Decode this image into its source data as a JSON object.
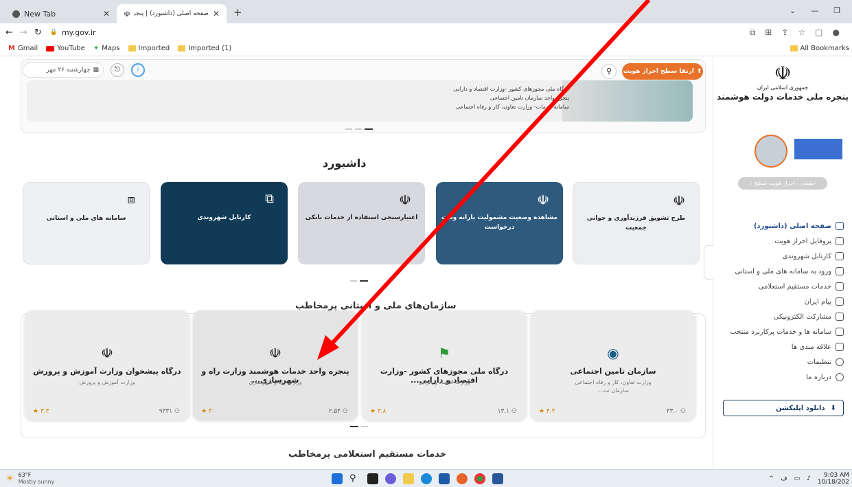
{
  "browser": {
    "tabs": [
      {
        "title": "New Tab"
      },
      {
        "title": "صفحه اصلی (داشبورد) | پنجره مل..."
      }
    ],
    "address": "my.gov.ir",
    "bookmarks": [
      "Gmail",
      "YouTube",
      "Maps",
      "Imported",
      "Imported (1)"
    ],
    "all_bookmarks": "All Bookmarks"
  },
  "header": {
    "date": "چهارشنبه ۲۶ مهر",
    "upgrade_button": "ارتقا سطح احراز هویت",
    "banner_lines": [
      "درگاه ملی مجوزهای کشور -وزارت اقتصاد و دارایی",
      "پنجره واحد سازمان تامین اجتماعی",
      "سامانه خدمات- وزارت تعاون، کار و رفاه اجتماعی"
    ]
  },
  "dashboard": {
    "title": "داشبورد",
    "cards": [
      {
        "label": "سامانه های ملی و استانی"
      },
      {
        "label": "کارتابل شهروندی"
      },
      {
        "label": "اعتبارسنجی استفاده از خدمات بانکی"
      },
      {
        "label": "مشاهده وضعیت مشمولیت یارانه وثبت درخواست"
      },
      {
        "label": "طرح تشویق فرزندآوری و جوانی جمعیت"
      }
    ]
  },
  "orgs": {
    "title": "سازمان‌های ملی و استانی پرمخاطب",
    "items": [
      {
        "title": "درگاه پیشخوان وزارت آموزش و پرورش",
        "sub": "وزارت آموزش و پرورش",
        "rating": "۳.۳",
        "count": "۹۳۳۱"
      },
      {
        "title": "پنجره واحد خدمات هوشمند وزارت راه و شهرسازی...",
        "sub": "وزارت راه و شهرسازی",
        "rating": "۳",
        "count": "۲.۵۴"
      },
      {
        "title": "درگاه ملی مجوزهای کشور -وزارت اقتصاد و دارایی...",
        "sub": "وزارت اقتصاد و دارایی",
        "rating": "۳.۸",
        "count": "۱۳.۱"
      },
      {
        "title": "سازمان تامین اجتماعی",
        "sub": "وزارت تعاون، کار و رفاه اجتماعی",
        "sub2": "سازمان تت...",
        "rating": "۴.۴",
        "count": "۳۳.۰"
      }
    ]
  },
  "inquiry_title": "خدمات مستقیم استعلامی پرمخاطب",
  "sidebar": {
    "logo_line1": "جمهوری اسلامی ایران",
    "logo_line2": "پنجره ملی خدمات دولت هوشمند",
    "auth_badge": "حقیقی - احراز هویت سطح ۱",
    "items": [
      {
        "label": "صفحه اصلی (داشبورد)",
        "icon": "grid-icon"
      },
      {
        "label": "پروفایل احراز هویت",
        "icon": "id-icon"
      },
      {
        "label": "کارتابل شهروندی",
        "icon": "folder-icon"
      },
      {
        "label": "ورود به سامانه های ملی و استانی",
        "icon": "window-icon"
      },
      {
        "label": "خدمات مستقیم استعلامی",
        "icon": "layers-icon"
      },
      {
        "label": "پیام ایران",
        "icon": "message-icon"
      },
      {
        "label": "مشارکت الکترونیکی",
        "icon": "star-icon"
      },
      {
        "label": "سامانه ها و خدمات پرکاربرد منتخب",
        "icon": "users-icon"
      },
      {
        "label": "علاقه مندی ها",
        "icon": "bookmark-icon"
      },
      {
        "label": "تنظیمات",
        "icon": "gear-icon"
      },
      {
        "label": "درباره ما",
        "icon": "phone-icon"
      }
    ],
    "download_app": "دانلود اپلیکشن"
  },
  "taskbar": {
    "weather_temp": "63°F",
    "weather_desc": "Mostly sunny",
    "time": "9:03 AM",
    "date": "10/18/202"
  },
  "colors": {
    "accent": "#e8722a",
    "navy": "#14395a",
    "annotation_arrow": "#ff0000"
  }
}
